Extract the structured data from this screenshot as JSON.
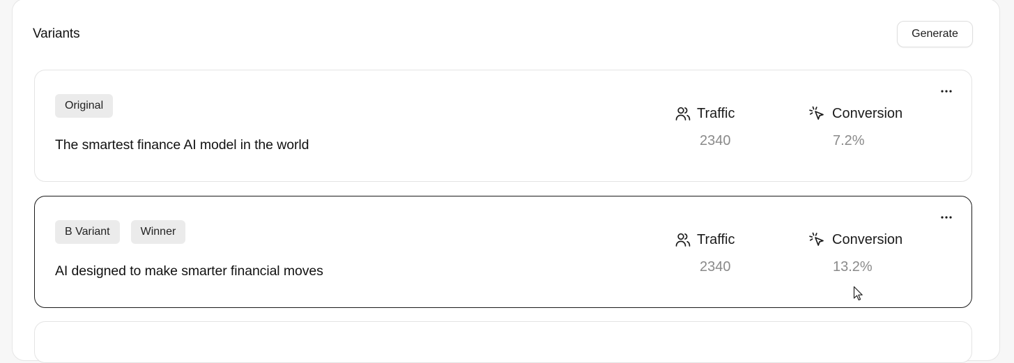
{
  "panel": {
    "title": "Variants",
    "generate_label": "Generate"
  },
  "variants": [
    {
      "badges": [
        "Original"
      ],
      "headline": "The smartest finance AI model in the world",
      "traffic_label": "Traffic",
      "traffic_value": "2340",
      "conversion_label": "Conversion",
      "conversion_value": "7.2%",
      "selected": false
    },
    {
      "badges": [
        "B Variant",
        "Winner"
      ],
      "headline": "AI designed to make smarter financial moves",
      "traffic_label": "Traffic",
      "traffic_value": "2340",
      "conversion_label": "Conversion",
      "conversion_value": "13.2%",
      "selected": true
    }
  ],
  "icons": {
    "traffic": "users-icon",
    "conversion": "click-cursor-icon",
    "more": "more-horizontal-icon",
    "pointer": "mouse-pointer-icon"
  },
  "colors": {
    "panel_bg": "#ffffff",
    "page_bg": "#f7f7f7",
    "badge_bg": "#ebebeb",
    "selected_border": "#1a1a1a",
    "value_text": "#8a8a8a"
  }
}
